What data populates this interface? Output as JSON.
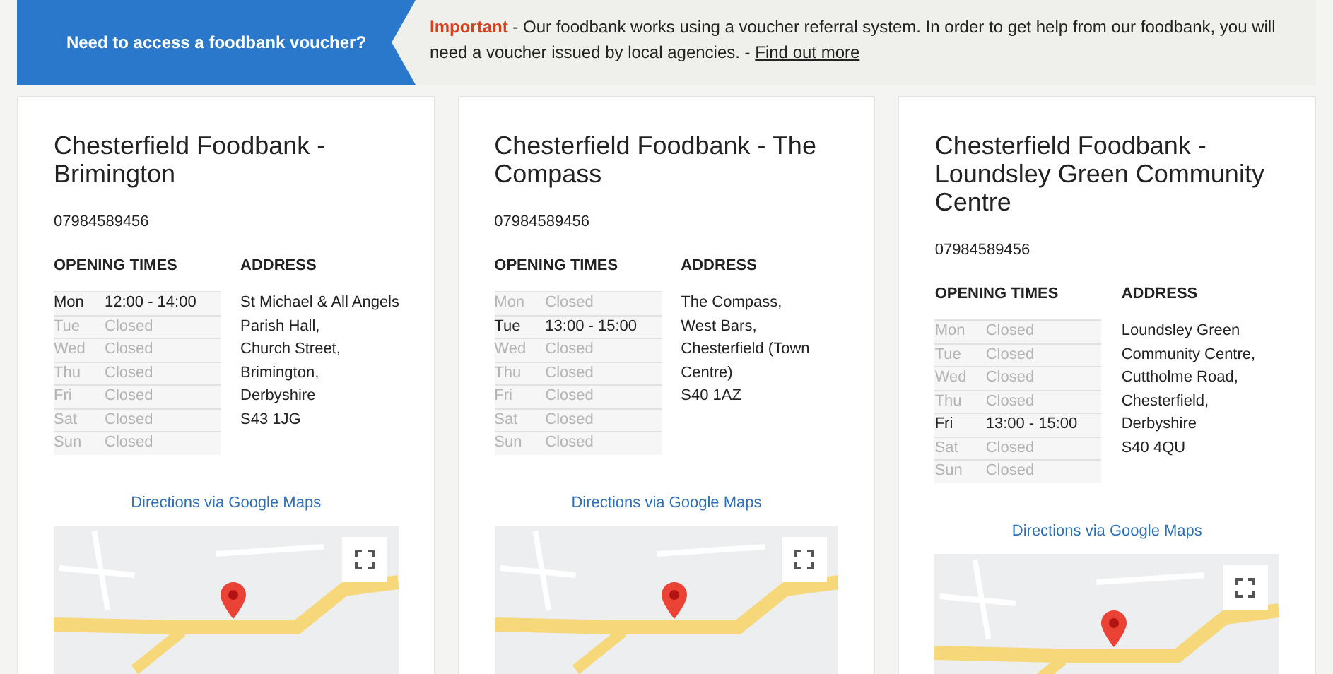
{
  "banner": {
    "button": "Need to access a foodbank voucher?",
    "notice": "**Important** - Our foodbank works using a voucher referral system. In order to get help from our foodbank, you will need a voucher issued by local agencies. - ",
    "link": "Find out more"
  },
  "foodbanks": [
    {
      "title": "Chesterfield Foodbank - Brimington",
      "phone": "07984589456",
      "times_heading": "OPENING TIMES",
      "address_heading": "ADDRESS",
      "times": [
        {
          "day": "Mon",
          "hours": "12:00 - 14:00",
          "open": true
        },
        {
          "day": "Tue",
          "hours": "Closed",
          "open": false
        },
        {
          "day": "Wed",
          "hours": "Closed",
          "open": false
        },
        {
          "day": "Thu",
          "hours": "Closed",
          "open": false
        },
        {
          "day": "Fri",
          "hours": "Closed",
          "open": false
        },
        {
          "day": "Sat",
          "hours": "Closed",
          "open": false
        },
        {
          "day": "Sun",
          "hours": "Closed",
          "open": false
        }
      ],
      "address": [
        "St Michael & All Angels",
        "Parish Hall,",
        "Church Street,",
        "Brimington,",
        "Derbyshire",
        "S43 1JG"
      ],
      "directions": "Directions via Google Maps"
    },
    {
      "title": "Chesterfield Foodbank - The Compass",
      "phone": "07984589456",
      "times_heading": "OPENING TIMES",
      "address_heading": "ADDRESS",
      "times": [
        {
          "day": "Mon",
          "hours": "Closed",
          "open": false
        },
        {
          "day": "Tue",
          "hours": "13:00 - 15:00",
          "open": true
        },
        {
          "day": "Wed",
          "hours": "Closed",
          "open": false
        },
        {
          "day": "Thu",
          "hours": "Closed",
          "open": false
        },
        {
          "day": "Fri",
          "hours": "Closed",
          "open": false
        },
        {
          "day": "Sat",
          "hours": "Closed",
          "open": false
        },
        {
          "day": "Sun",
          "hours": "Closed",
          "open": false
        }
      ],
      "address": [
        "The Compass,",
        "West Bars,",
        "Chesterfield (Town",
        "Centre)",
        "S40 1AZ"
      ],
      "directions": "Directions via Google Maps"
    },
    {
      "title": "Chesterfield Foodbank - Loundsley Green Community Centre",
      "phone": "07984589456",
      "times_heading": "OPENING TIMES",
      "address_heading": "ADDRESS",
      "times": [
        {
          "day": "Mon",
          "hours": "Closed",
          "open": false
        },
        {
          "day": "Tue",
          "hours": "Closed",
          "open": false
        },
        {
          "day": "Wed",
          "hours": "Closed",
          "open": false
        },
        {
          "day": "Thu",
          "hours": "Closed",
          "open": false
        },
        {
          "day": "Fri",
          "hours": "13:00 - 15:00",
          "open": true
        },
        {
          "day": "Sat",
          "hours": "Closed",
          "open": false
        },
        {
          "day": "Sun",
          "hours": "Closed",
          "open": false
        }
      ],
      "address": [
        "Loundsley Green",
        "Community Centre,",
        "Cuttholme Road,",
        "Chesterfield,",
        "Derbyshire",
        "S40 4QU"
      ],
      "directions": "Directions via Google Maps"
    }
  ]
}
